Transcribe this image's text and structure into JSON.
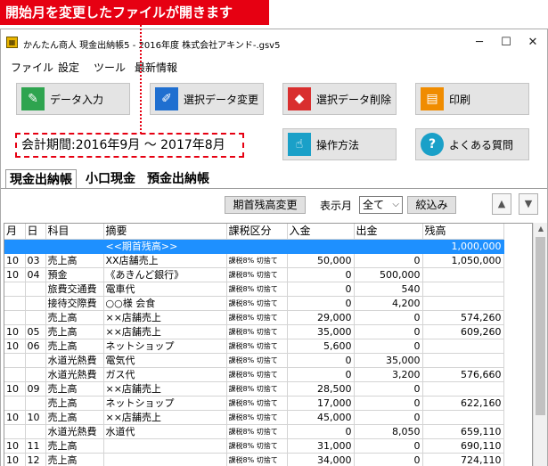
{
  "callout": {
    "text": "開始月を変更したファイルが開きます"
  },
  "window": {
    "title": "かんたん商人 現金出納帳5 - 2016年度 株式会社アキンド-.gsv5",
    "app_icon": "ledger-app-icon"
  },
  "window_controls": {
    "minimize": "─",
    "maximize": "☐",
    "close": "✕"
  },
  "menu": [
    "ファイル",
    "設定",
    "ツール",
    "最新情報"
  ],
  "toolbar": {
    "data_entry": {
      "label": "データ入力",
      "icon": "pen-icon",
      "color": "#2ea44f"
    },
    "edit_selected": {
      "label": "選択データ変更",
      "icon": "pencil-icon",
      "color": "#1f6fd0"
    },
    "delete_selected": {
      "label": "選択データ削除",
      "icon": "eraser-icon",
      "color": "#d92f2f"
    },
    "print": {
      "label": "印刷",
      "icon": "document-icon",
      "color": "#f08c00"
    },
    "operation": {
      "label": "操作方法",
      "icon": "hand-pointer-icon",
      "color": "#1aa0c8"
    },
    "faq": {
      "label": "よくある質問",
      "icon": "question-icon",
      "color": "#1aa0c8"
    }
  },
  "period": {
    "label": "会計期間:2016年9月 ～ 2017年8月"
  },
  "tabs": [
    "現金出納帳",
    "小口現金",
    "預金出納帳"
  ],
  "filter": {
    "change_opening_balance": "期首残高変更",
    "display_month_label": "表示月",
    "month_value": "全て",
    "narrow_button": "絞込み",
    "up_arrow": "▲",
    "down_arrow": "▼"
  },
  "table": {
    "headers": [
      "月",
      "日",
      "科目",
      "摘要",
      "課税区分",
      "入金",
      "出金",
      "残高"
    ],
    "rows": [
      {
        "m": "",
        "d": "",
        "acct": "",
        "desc": "<<期首残高>>",
        "tax": "",
        "in": "",
        "out": "",
        "bal": "1,000,000",
        "highlight": true
      },
      {
        "m": "10",
        "d": "03",
        "acct": "売上高",
        "desc": "XX店舗売上",
        "tax": "課税8% 切捨て",
        "in": "50,000",
        "out": "0",
        "bal": "1,050,000"
      },
      {
        "m": "10",
        "d": "04",
        "acct": "預金",
        "desc": "《あきんど銀行》",
        "tax": "課税8% 切捨て",
        "in": "0",
        "out": "500,000",
        "bal": ""
      },
      {
        "m": "",
        "d": "",
        "acct": "旅費交通費",
        "desc": "電車代",
        "tax": "課税8% 切捨て",
        "in": "0",
        "out": "540",
        "bal": ""
      },
      {
        "m": "",
        "d": "",
        "acct": "接待交際費",
        "desc": "○○様 会食",
        "tax": "課税8% 切捨て",
        "in": "0",
        "out": "4,200",
        "bal": ""
      },
      {
        "m": "",
        "d": "",
        "acct": "売上高",
        "desc": "××店舗売上",
        "tax": "課税8% 切捨て",
        "in": "29,000",
        "out": "0",
        "bal": "574,260"
      },
      {
        "m": "10",
        "d": "05",
        "acct": "売上高",
        "desc": "××店舗売上",
        "tax": "課税8% 切捨て",
        "in": "35,000",
        "out": "0",
        "bal": "609,260"
      },
      {
        "m": "10",
        "d": "06",
        "acct": "売上高",
        "desc": "ネットショップ",
        "tax": "課税8% 切捨て",
        "in": "5,600",
        "out": "0",
        "bal": ""
      },
      {
        "m": "",
        "d": "",
        "acct": "水道光熱費",
        "desc": "電気代",
        "tax": "課税8% 切捨て",
        "in": "0",
        "out": "35,000",
        "bal": ""
      },
      {
        "m": "",
        "d": "",
        "acct": "水道光熱費",
        "desc": "ガス代",
        "tax": "課税8% 切捨て",
        "in": "0",
        "out": "3,200",
        "bal": "576,660"
      },
      {
        "m": "10",
        "d": "09",
        "acct": "売上高",
        "desc": "××店舗売上",
        "tax": "課税8% 切捨て",
        "in": "28,500",
        "out": "0",
        "bal": ""
      },
      {
        "m": "",
        "d": "",
        "acct": "売上高",
        "desc": "ネットショップ",
        "tax": "課税8% 切捨て",
        "in": "17,000",
        "out": "0",
        "bal": "622,160"
      },
      {
        "m": "10",
        "d": "10",
        "acct": "売上高",
        "desc": "××店舗売上",
        "tax": "課税8% 切捨て",
        "in": "45,000",
        "out": "0",
        "bal": ""
      },
      {
        "m": "",
        "d": "",
        "acct": "水道光熱費",
        "desc": "水道代",
        "tax": "課税8% 切捨て",
        "in": "0",
        "out": "8,050",
        "bal": "659,110"
      },
      {
        "m": "10",
        "d": "11",
        "acct": "売上高",
        "desc": "",
        "tax": "課税8% 切捨て",
        "in": "31,000",
        "out": "0",
        "bal": "690,110"
      },
      {
        "m": "10",
        "d": "12",
        "acct": "売上高",
        "desc": "",
        "tax": "課税8% 切捨て",
        "in": "34,000",
        "out": "0",
        "bal": "724,110"
      }
    ]
  },
  "colors": {
    "callout": "#e60012",
    "highlight_row": "#1e90ff"
  }
}
